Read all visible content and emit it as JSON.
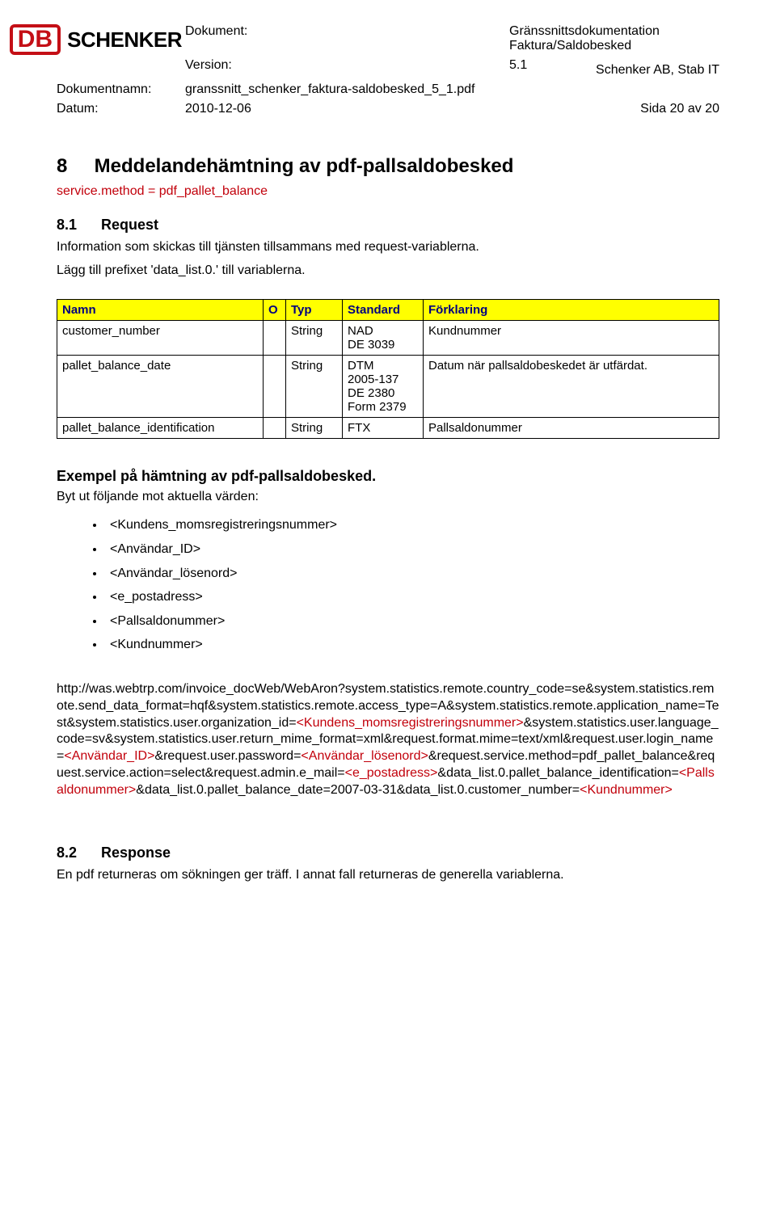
{
  "header": {
    "label_dokument": "Dokument:",
    "dokument_line1": "Gränssnittsdokumentation",
    "dokument_line2": "Faktura/Saldobesked",
    "label_version": "Version:",
    "version": "5.1",
    "org": "Schenker AB, Stab IT",
    "label_dokumentnamn": "Dokumentnamn:",
    "dokumentnamn": "granssnitt_schenker_faktura-saldobesked_5_1.pdf",
    "label_datum": "Datum:",
    "datum": "2010-12-06",
    "sida": "Sida 20 av 20",
    "logo_db": "DB",
    "logo_schenker": "SCHENKER"
  },
  "section8": {
    "num": "8",
    "title": "Meddelandehämtning av pdf-pallsaldobesked",
    "service_line": "service.method = pdf_pallet_balance"
  },
  "section81": {
    "num": "8.1",
    "title": "Request",
    "p1": "Information som skickas till tjänsten tillsammans med request-variablerna.",
    "p2": "Lägg till prefixet 'data_list.0.' till variablerna."
  },
  "table": {
    "headers": {
      "namn": "Namn",
      "o": "O",
      "typ": "Typ",
      "standard": "Standard",
      "forklaring": "Förklaring"
    },
    "rows": [
      {
        "namn": "customer_number",
        "o": "",
        "typ": "String",
        "standard": "NAD\nDE 3039",
        "forklaring": "Kundnummer"
      },
      {
        "namn": "pallet_balance_date",
        "o": "",
        "typ": "String",
        "standard": "DTM\n2005-137\nDE 2380\nForm 2379",
        "forklaring": "Datum när pallsaldobeskedet är utfärdat."
      },
      {
        "namn": "pallet_balance_identification",
        "o": "",
        "typ": "String",
        "standard": "FTX",
        "forklaring": "Pallsaldonummer"
      }
    ]
  },
  "example": {
    "heading": "Exempel på hämtning av pdf-pallsaldobesked.",
    "intro": "Byt ut följande mot aktuella värden:",
    "items": [
      "<Kundens_momsregistreringsnummer>",
      "<Användar_ID>",
      "<Användar_lösenord>",
      "<e_postadress>",
      "<Pallsaldonummer>",
      "<Kundnummer>"
    ]
  },
  "url": {
    "p1a": "http://was.webtrp.com/invoice_docWeb/WebAron?system.statistics.remote.country_code=se&system.statistics.remote.send_data_format=hqf&system.statistics.remote.access_type=A&system.statistics.remote.application_name=Test&system.statistics.user.organization_id=",
    "v1": "<Kundens_momsregistreringsnummer>",
    "p1b": "&system.statistics.user.language_code=sv&system.statistics.user.return_mime_format=xml&request.format.mime=text/xml&request.user.login_name=",
    "v2": "<Användar_ID>",
    "p1c": "&request.user.password=",
    "v3": "<Användar_lösenord>",
    "p1d": "&request.service.method=pdf_pallet_balance&request.service.action=select&request.admin.e_mail=",
    "v4": "<e_postadress>",
    "p1e": "&data_list.0.pallet_balance_identification=",
    "v5": "<Pallsaldonummer>",
    "p1f": "&data_list.0.pallet_balance_date=2007-03-31&data_list.0.customer_number=",
    "v6": "<Kundnummer>"
  },
  "section82": {
    "num": "8.2",
    "title": "Response",
    "p": "En pdf returneras om sökningen ger träff. I annat fall returneras de generella variablerna."
  }
}
